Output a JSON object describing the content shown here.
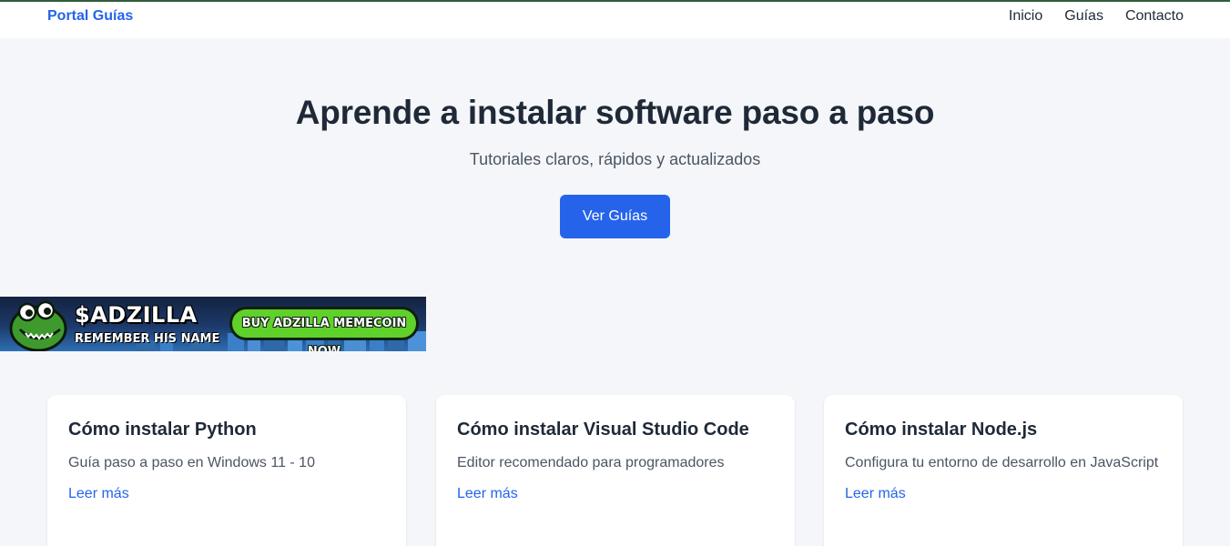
{
  "header": {
    "brand": "Portal Guías",
    "nav": [
      "Inicio",
      "Guías",
      "Contacto"
    ]
  },
  "hero": {
    "title": "Aprende a instalar software paso a paso",
    "subtitle": "Tutoriales claros, rápidos y actualizados",
    "cta_label": "Ver Guías"
  },
  "ad": {
    "title": "$ADZILLA",
    "tagline": "REMEMBER HIS NAME",
    "button_label": "BUY ADZILLA MEMECOIN NOW",
    "icon": "crocodile-mascot-icon"
  },
  "cards": [
    {
      "title": "Cómo instalar Python",
      "description": "Guía paso a paso en Windows 11 - 10",
      "link": "Leer más"
    },
    {
      "title": "Cómo instalar Visual Studio Code",
      "description": "Editor recomendado para programadores",
      "link": "Leer más"
    },
    {
      "title": "Cómo instalar Node.js",
      "description": "Configura tu entorno de desarrollo en JavaScript",
      "link": "Leer más"
    }
  ],
  "colors": {
    "accent": "#2563eb",
    "background": "#f4f6f9",
    "text": "#1f2937",
    "ad_button": "#5fd12a"
  }
}
